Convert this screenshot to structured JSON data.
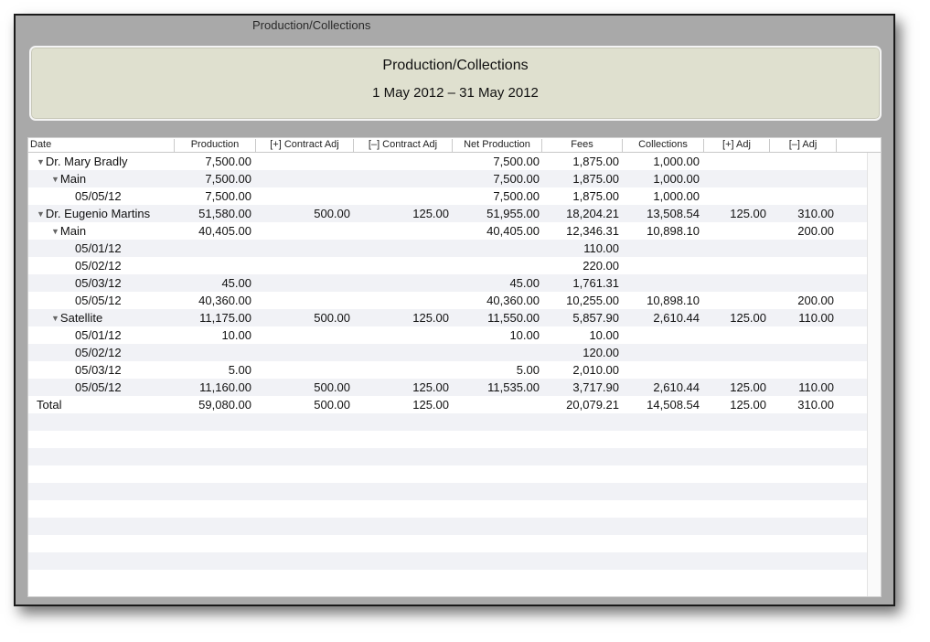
{
  "window": {
    "title": "Production/Collections"
  },
  "report": {
    "title": "Production/Collections",
    "date_range": "1 May 2012 – 31 May 2012"
  },
  "columns": [
    "Date",
    "Production",
    "[+] Contract Adj",
    "[–] Contract Adj",
    "Net Production",
    "Fees",
    "Collections",
    "[+] Adj",
    "[–] Adj"
  ],
  "rows": [
    {
      "level": 0,
      "expander": true,
      "label": "Dr. Mary Bradly",
      "cells": [
        "7,500.00",
        "",
        "",
        "7,500.00",
        "1,875.00",
        "1,000.00",
        "",
        ""
      ]
    },
    {
      "level": 1,
      "expander": true,
      "label": "Main",
      "cells": [
        "7,500.00",
        "",
        "",
        "7,500.00",
        "1,875.00",
        "1,000.00",
        "",
        ""
      ]
    },
    {
      "level": 2,
      "expander": false,
      "label": "05/05/12",
      "cells": [
        "7,500.00",
        "",
        "",
        "7,500.00",
        "1,875.00",
        "1,000.00",
        "",
        ""
      ]
    },
    {
      "level": 0,
      "expander": true,
      "label": "Dr. Eugenio Martins",
      "cells": [
        "51,580.00",
        "500.00",
        "125.00",
        "51,955.00",
        "18,204.21",
        "13,508.54",
        "125.00",
        "310.00"
      ]
    },
    {
      "level": 1,
      "expander": true,
      "label": "Main",
      "cells": [
        "40,405.00",
        "",
        "",
        "40,405.00",
        "12,346.31",
        "10,898.10",
        "",
        "200.00"
      ]
    },
    {
      "level": 2,
      "expander": false,
      "label": "05/01/12",
      "cells": [
        "",
        "",
        "",
        "",
        "110.00",
        "",
        "",
        ""
      ]
    },
    {
      "level": 2,
      "expander": false,
      "label": "05/02/12",
      "cells": [
        "",
        "",
        "",
        "",
        "220.00",
        "",
        "",
        ""
      ]
    },
    {
      "level": 2,
      "expander": false,
      "label": "05/03/12",
      "cells": [
        "45.00",
        "",
        "",
        "45.00",
        "1,761.31",
        "",
        "",
        ""
      ]
    },
    {
      "level": 2,
      "expander": false,
      "label": "05/05/12",
      "cells": [
        "40,360.00",
        "",
        "",
        "40,360.00",
        "10,255.00",
        "10,898.10",
        "",
        "200.00"
      ]
    },
    {
      "level": 1,
      "expander": true,
      "label": "Satellite",
      "cells": [
        "11,175.00",
        "500.00",
        "125.00",
        "11,550.00",
        "5,857.90",
        "2,610.44",
        "125.00",
        "110.00"
      ]
    },
    {
      "level": 2,
      "expander": false,
      "label": "05/01/12",
      "cells": [
        "10.00",
        "",
        "",
        "10.00",
        "10.00",
        "",
        "",
        ""
      ]
    },
    {
      "level": 2,
      "expander": false,
      "label": "05/02/12",
      "cells": [
        "",
        "",
        "",
        "",
        "120.00",
        "",
        "",
        ""
      ]
    },
    {
      "level": 2,
      "expander": false,
      "label": "05/03/12",
      "cells": [
        "5.00",
        "",
        "",
        "5.00",
        "2,010.00",
        "",
        "",
        ""
      ]
    },
    {
      "level": 2,
      "expander": false,
      "label": "05/05/12",
      "cells": [
        "11,160.00",
        "500.00",
        "125.00",
        "11,535.00",
        "3,717.90",
        "2,610.44",
        "125.00",
        "110.00"
      ]
    },
    {
      "level": 0,
      "expander": false,
      "label": "Total",
      "cells": [
        "59,080.00",
        "500.00",
        "125.00",
        "",
        "20,079.21",
        "14,508.54",
        "125.00",
        "310.00"
      ]
    }
  ],
  "empty_rows": 10,
  "icons": {
    "expander": "disclosure-triangle-down-icon"
  },
  "colors": {
    "header_bg": "#dfe0cf",
    "alt_row": "#f1f2f6"
  }
}
